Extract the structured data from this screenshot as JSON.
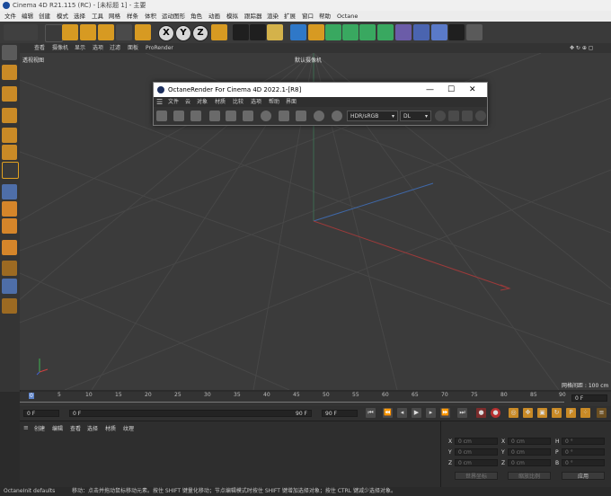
{
  "window": {
    "title": "Cinema 4D R21.115 (RC) - [未标题 1] - 主要"
  },
  "menubar": [
    "文件",
    "编辑",
    "创建",
    "模式",
    "选择",
    "工具",
    "网格",
    "样条",
    "体积",
    "运动图形",
    "角色",
    "动画",
    "模拟",
    "跟踪器",
    "渲染",
    "扩展",
    "窗口",
    "帮助",
    "Octane"
  ],
  "toolbar": {
    "axes": [
      "X",
      "Y",
      "Z"
    ]
  },
  "viewport": {
    "menu": [
      "查看",
      "摄像机",
      "显示",
      "选项",
      "过滤",
      "面板",
      "ProRender"
    ],
    "view_name": "透视视图",
    "camera_label": "默认摄像机 ",
    "grid_spacing": "网格间距 : 100 cm"
  },
  "octane": {
    "title": "OctaneRender For Cinema 4D 2022.1-[R8]",
    "menu": [
      "文件",
      "云",
      "对象",
      "材质",
      "比较",
      "选项",
      "帮助",
      "界面"
    ],
    "colorspace": "HDR/sRGB",
    "kernel": "DL"
  },
  "timeline": {
    "ticks": [
      "0",
      "5",
      "10",
      "15",
      "20",
      "25",
      "30",
      "35",
      "40",
      "45",
      "50",
      "55",
      "60",
      "65",
      "70",
      "75",
      "80",
      "85",
      "90"
    ],
    "current_frame": "0 F"
  },
  "transport": {
    "start": "0 F",
    "current": "0 F",
    "end": "90 F",
    "end2": "90 F"
  },
  "materials": {
    "tabs": [
      "创建",
      "编辑",
      "查看",
      "选择",
      "材质",
      "纹理"
    ]
  },
  "coords": {
    "rows": [
      {
        "a": "X",
        "a_val": "0 cm",
        "b": "X",
        "b_val": "0 cm",
        "c": "H",
        "c_val": "0 °"
      },
      {
        "a": "Y",
        "a_val": "0 cm",
        "b": "Y",
        "b_val": "0 cm",
        "c": "P",
        "c_val": "0 °"
      },
      {
        "a": "Z",
        "a_val": "0 cm",
        "b": "Z",
        "b_val": "0 cm",
        "c": "B",
        "c_val": "0 °"
      }
    ],
    "mode1": "世界坐标",
    "mode2": "缩放比例",
    "apply": "应用"
  },
  "status": {
    "left": "OctaneInit defaults",
    "message": "移动：点击并拖动鼠标移动元素。按住 SHIFT 键量化移动；节点编辑模式时按住 SHIFT 键增加选择对象；按住 CTRL 键减少选择对象。"
  }
}
